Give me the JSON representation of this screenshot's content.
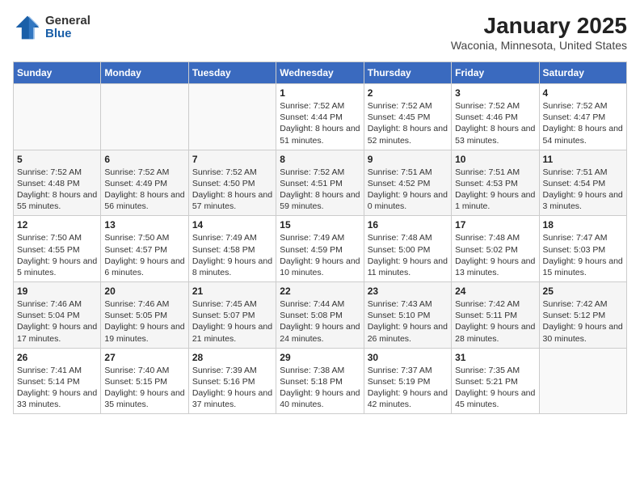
{
  "header": {
    "logo_general": "General",
    "logo_blue": "Blue",
    "title": "January 2025",
    "subtitle": "Waconia, Minnesota, United States"
  },
  "days_of_week": [
    "Sunday",
    "Monday",
    "Tuesday",
    "Wednesday",
    "Thursday",
    "Friday",
    "Saturday"
  ],
  "weeks": [
    [
      {
        "day": "",
        "info": ""
      },
      {
        "day": "",
        "info": ""
      },
      {
        "day": "",
        "info": ""
      },
      {
        "day": "1",
        "info": "Sunrise: 7:52 AM\nSunset: 4:44 PM\nDaylight: 8 hours and 51 minutes."
      },
      {
        "day": "2",
        "info": "Sunrise: 7:52 AM\nSunset: 4:45 PM\nDaylight: 8 hours and 52 minutes."
      },
      {
        "day": "3",
        "info": "Sunrise: 7:52 AM\nSunset: 4:46 PM\nDaylight: 8 hours and 53 minutes."
      },
      {
        "day": "4",
        "info": "Sunrise: 7:52 AM\nSunset: 4:47 PM\nDaylight: 8 hours and 54 minutes."
      }
    ],
    [
      {
        "day": "5",
        "info": "Sunrise: 7:52 AM\nSunset: 4:48 PM\nDaylight: 8 hours and 55 minutes."
      },
      {
        "day": "6",
        "info": "Sunrise: 7:52 AM\nSunset: 4:49 PM\nDaylight: 8 hours and 56 minutes."
      },
      {
        "day": "7",
        "info": "Sunrise: 7:52 AM\nSunset: 4:50 PM\nDaylight: 8 hours and 57 minutes."
      },
      {
        "day": "8",
        "info": "Sunrise: 7:52 AM\nSunset: 4:51 PM\nDaylight: 8 hours and 59 minutes."
      },
      {
        "day": "9",
        "info": "Sunrise: 7:51 AM\nSunset: 4:52 PM\nDaylight: 9 hours and 0 minutes."
      },
      {
        "day": "10",
        "info": "Sunrise: 7:51 AM\nSunset: 4:53 PM\nDaylight: 9 hours and 1 minute."
      },
      {
        "day": "11",
        "info": "Sunrise: 7:51 AM\nSunset: 4:54 PM\nDaylight: 9 hours and 3 minutes."
      }
    ],
    [
      {
        "day": "12",
        "info": "Sunrise: 7:50 AM\nSunset: 4:55 PM\nDaylight: 9 hours and 5 minutes."
      },
      {
        "day": "13",
        "info": "Sunrise: 7:50 AM\nSunset: 4:57 PM\nDaylight: 9 hours and 6 minutes."
      },
      {
        "day": "14",
        "info": "Sunrise: 7:49 AM\nSunset: 4:58 PM\nDaylight: 9 hours and 8 minutes."
      },
      {
        "day": "15",
        "info": "Sunrise: 7:49 AM\nSunset: 4:59 PM\nDaylight: 9 hours and 10 minutes."
      },
      {
        "day": "16",
        "info": "Sunrise: 7:48 AM\nSunset: 5:00 PM\nDaylight: 9 hours and 11 minutes."
      },
      {
        "day": "17",
        "info": "Sunrise: 7:48 AM\nSunset: 5:02 PM\nDaylight: 9 hours and 13 minutes."
      },
      {
        "day": "18",
        "info": "Sunrise: 7:47 AM\nSunset: 5:03 PM\nDaylight: 9 hours and 15 minutes."
      }
    ],
    [
      {
        "day": "19",
        "info": "Sunrise: 7:46 AM\nSunset: 5:04 PM\nDaylight: 9 hours and 17 minutes."
      },
      {
        "day": "20",
        "info": "Sunrise: 7:46 AM\nSunset: 5:05 PM\nDaylight: 9 hours and 19 minutes."
      },
      {
        "day": "21",
        "info": "Sunrise: 7:45 AM\nSunset: 5:07 PM\nDaylight: 9 hours and 21 minutes."
      },
      {
        "day": "22",
        "info": "Sunrise: 7:44 AM\nSunset: 5:08 PM\nDaylight: 9 hours and 24 minutes."
      },
      {
        "day": "23",
        "info": "Sunrise: 7:43 AM\nSunset: 5:10 PM\nDaylight: 9 hours and 26 minutes."
      },
      {
        "day": "24",
        "info": "Sunrise: 7:42 AM\nSunset: 5:11 PM\nDaylight: 9 hours and 28 minutes."
      },
      {
        "day": "25",
        "info": "Sunrise: 7:42 AM\nSunset: 5:12 PM\nDaylight: 9 hours and 30 minutes."
      }
    ],
    [
      {
        "day": "26",
        "info": "Sunrise: 7:41 AM\nSunset: 5:14 PM\nDaylight: 9 hours and 33 minutes."
      },
      {
        "day": "27",
        "info": "Sunrise: 7:40 AM\nSunset: 5:15 PM\nDaylight: 9 hours and 35 minutes."
      },
      {
        "day": "28",
        "info": "Sunrise: 7:39 AM\nSunset: 5:16 PM\nDaylight: 9 hours and 37 minutes."
      },
      {
        "day": "29",
        "info": "Sunrise: 7:38 AM\nSunset: 5:18 PM\nDaylight: 9 hours and 40 minutes."
      },
      {
        "day": "30",
        "info": "Sunrise: 7:37 AM\nSunset: 5:19 PM\nDaylight: 9 hours and 42 minutes."
      },
      {
        "day": "31",
        "info": "Sunrise: 7:35 AM\nSunset: 5:21 PM\nDaylight: 9 hours and 45 minutes."
      },
      {
        "day": "",
        "info": ""
      }
    ]
  ]
}
